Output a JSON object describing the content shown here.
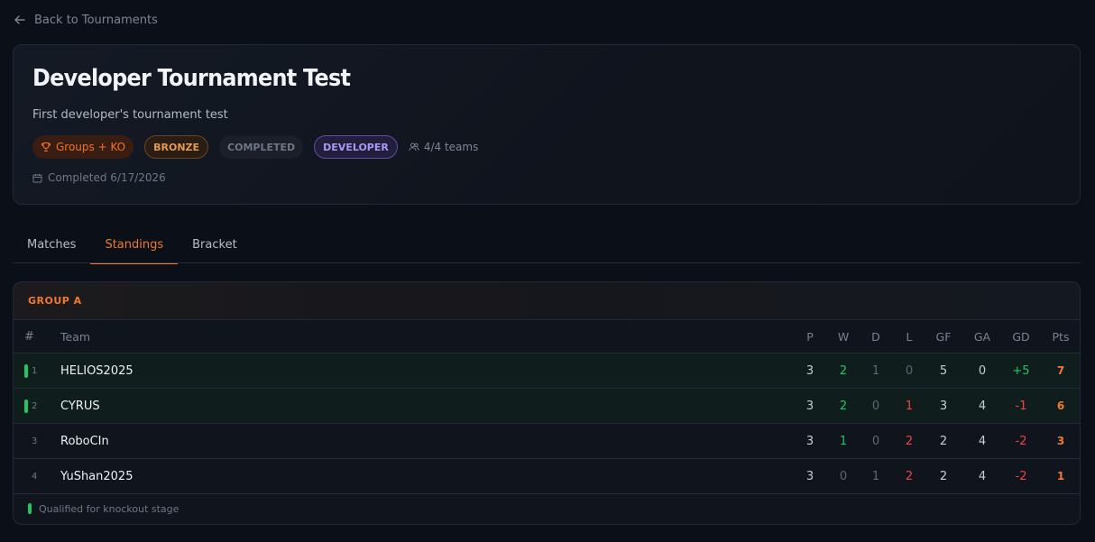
{
  "back": {
    "label": "Back to Tournaments",
    "icon": "arrow-left-icon"
  },
  "tournament": {
    "title": "Developer Tournament Test",
    "description": "First developer's tournament test",
    "format": "Groups + KO",
    "tier": "BRONZE",
    "status": "COMPLETED",
    "category": "DEVELOPER",
    "teams": "4/4 teams",
    "completed": "Completed 6/17/2026"
  },
  "tabs": [
    {
      "label": "Matches",
      "active": false
    },
    {
      "label": "Standings",
      "active": true
    },
    {
      "label": "Bracket",
      "active": false
    }
  ],
  "standings": {
    "group_name": "GROUP A",
    "columns": {
      "rank": "#",
      "team": "Team",
      "p": "P",
      "w": "W",
      "d": "D",
      "l": "L",
      "gf": "GF",
      "ga": "GA",
      "gd": "GD",
      "pts": "Pts"
    },
    "rows": [
      {
        "rank": "1",
        "team": "HELIOS2025",
        "p": "3",
        "w": "2",
        "d": "1",
        "l": "0",
        "gf": "5",
        "ga": "0",
        "gd": "+5",
        "pts": "7",
        "qualified": true
      },
      {
        "rank": "2",
        "team": "CYRUS",
        "p": "3",
        "w": "2",
        "d": "0",
        "l": "1",
        "gf": "3",
        "ga": "4",
        "gd": "-1",
        "pts": "6",
        "qualified": true
      },
      {
        "rank": "3",
        "team": "RoboCIn",
        "p": "3",
        "w": "1",
        "d": "0",
        "l": "2",
        "gf": "2",
        "ga": "4",
        "gd": "-2",
        "pts": "3",
        "qualified": false
      },
      {
        "rank": "4",
        "team": "YuShan2025",
        "p": "3",
        "w": "0",
        "d": "1",
        "l": "2",
        "gf": "2",
        "ga": "4",
        "gd": "-2",
        "pts": "1",
        "qualified": false
      }
    ],
    "legend": "Qualified for knockout stage"
  },
  "colors": {
    "accent": "#f2782f",
    "win": "#22c55e",
    "loss": "#ef4444",
    "qualified": "#22c55e"
  }
}
